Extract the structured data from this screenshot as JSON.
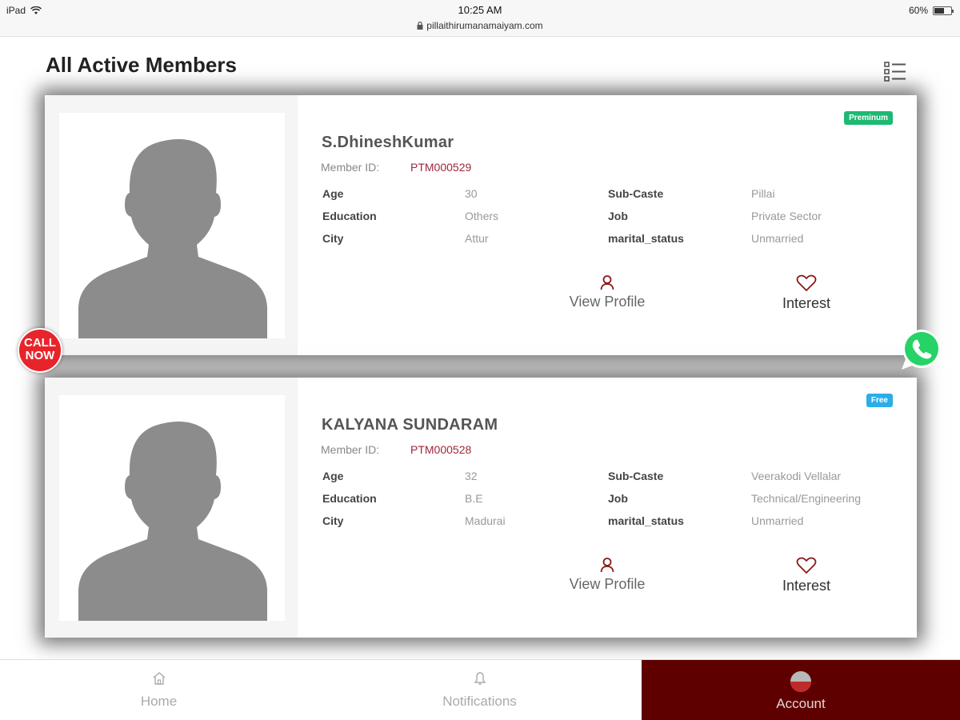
{
  "status_bar": {
    "device": "iPad",
    "time": "10:25 AM",
    "url": "pillaithirumanamaiyam.com",
    "battery": "60%",
    "battery_level": 0.6
  },
  "page": {
    "title": "All Active Members"
  },
  "labels": {
    "member_id": "Member ID:",
    "age": "Age",
    "education": "Education",
    "city": "City",
    "sub_caste": "Sub-Caste",
    "job": "Job",
    "marital_status": "marital_status",
    "view_profile": "View Profile",
    "interest": "Interest"
  },
  "members": [
    {
      "name": "S.DhineshKumar",
      "member_id": "PTM000529",
      "badge": "Preminum",
      "badge_color": "#1fb873",
      "age": "30",
      "education": "Others",
      "city": "Attur",
      "sub_caste": "Pillai",
      "job": "Private Sector",
      "marital_status": "Unmarried"
    },
    {
      "name": "KALYANA SUNDARAM",
      "member_id": "PTM000528",
      "badge": "Free",
      "badge_color": "#2aaee8",
      "age": "32",
      "education": "B.E",
      "city": "Madurai",
      "sub_caste": "Veerakodi Vellalar",
      "job": "Technical/Engineering",
      "marital_status": "Unmarried"
    }
  ],
  "floating": {
    "call_line1": "CALL",
    "call_line2": "NOW"
  },
  "nav": {
    "home": "Home",
    "notifications": "Notifications",
    "account": "Account"
  },
  "colors": {
    "accent": "#5e0000",
    "id_color": "#a0263a",
    "call_red": "#e8242b",
    "whatsapp_green": "#25d366"
  }
}
